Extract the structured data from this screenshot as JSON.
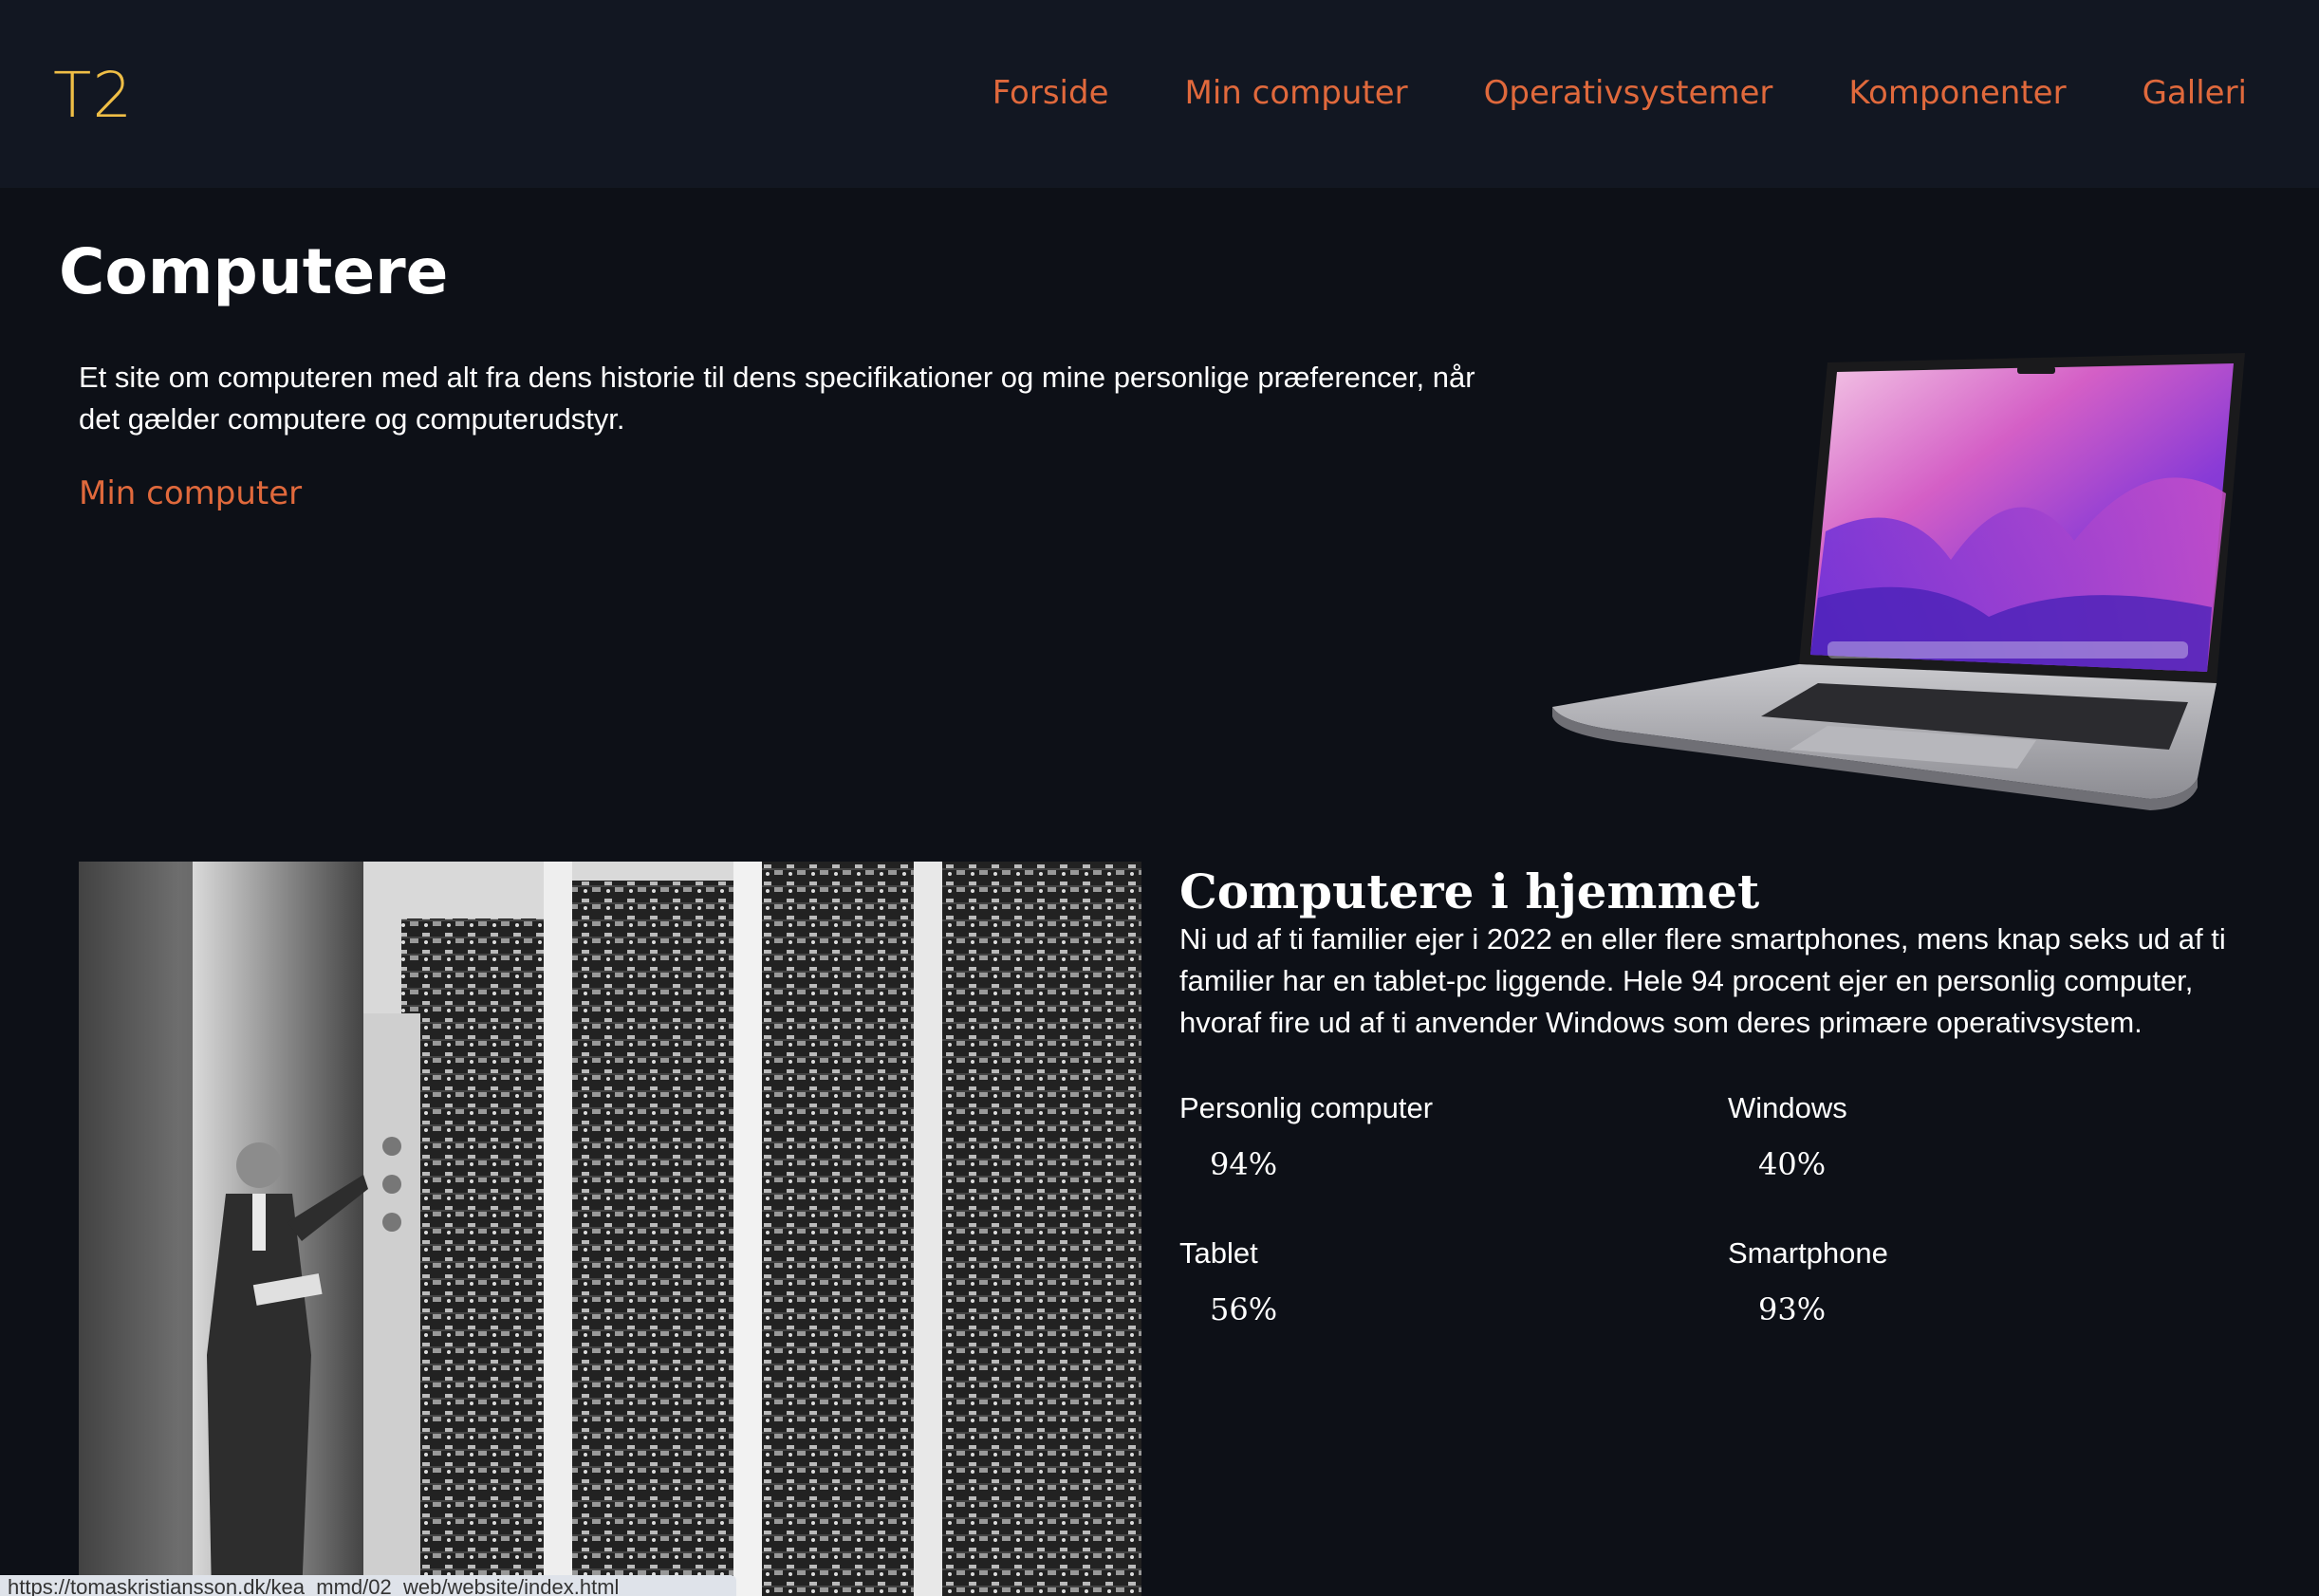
{
  "header": {
    "logo": "T2",
    "nav": [
      "Forside",
      "Min computer",
      "Operativsystemer",
      "Komponenter",
      "Galleri"
    ]
  },
  "hero": {
    "title": "Computere",
    "intro": "Et site om computeren med alt fra dens historie til dens specifikationer og mine personlige præferencer, når det gælder computere og computerudstyr.",
    "link": "Min computer"
  },
  "section": {
    "title": "Computere i hjemmet",
    "text": "Ni ud af ti familier ejer i 2022 en eller flere smartphones, mens knap seks ud af ti familier har en tablet-pc liggende. Hele 94 procent ejer en personlig computer, hvoraf fire ud af ti anvender Windows som deres primære operativsystem.",
    "stats": [
      {
        "label": "Personlig computer",
        "value": "94%"
      },
      {
        "label": "Windows",
        "value": "40%"
      },
      {
        "label": "Tablet",
        "value": "56%"
      },
      {
        "label": "Smartphone",
        "value": "93%"
      }
    ]
  },
  "status_bar": {
    "url": "https://tomaskristiansson.dk/kea_mmd/02_web/website/index.html"
  },
  "colors": {
    "background": "#0d1017",
    "header": "#121722",
    "logo": "#efbe46",
    "link": "#e0693c"
  }
}
